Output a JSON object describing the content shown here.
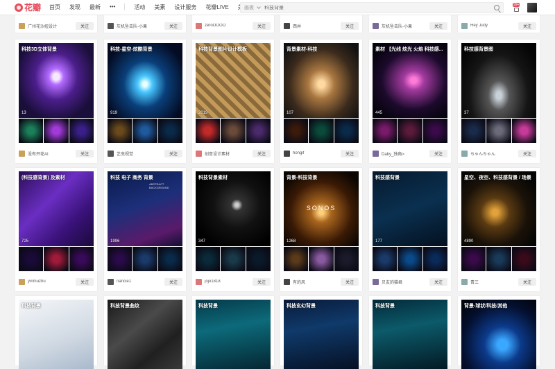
{
  "brand": {
    "logo_text": "花瓣",
    "accent": "#e54d5b"
  },
  "nav": {
    "items": [
      "首页",
      "发现",
      "最新"
    ],
    "more": "•••",
    "items2": [
      "活动",
      "美素",
      "设计服务",
      "花瓣LIVE",
      "美物"
    ]
  },
  "search": {
    "scope": "画板",
    "query": "科技背景"
  },
  "notifications": {
    "badge": "99+"
  },
  "follow_label": "关注",
  "top_row": [
    {
      "user": "广州花沙纽设计"
    },
    {
      "user": "灰机坠击队-小果"
    },
    {
      "user": "zeroOOOO"
    },
    {
      "user": "西井"
    },
    {
      "user": "灰机坠击队-小果"
    },
    {
      "user": "Hey Judy"
    }
  ],
  "row1": [
    {
      "title": "科技3D立体背景",
      "count": "13",
      "user": "没有开花AI"
    },
    {
      "title": "科技-星空-炫酷背景",
      "count": "919",
      "user": "艺虫视觉"
    },
    {
      "title": "科技背景图片设计模板",
      "count": "2019",
      "user": "创意设计素材"
    },
    {
      "title": "背景素材-科技",
      "count": "107",
      "user": "hongif"
    },
    {
      "title": "素材 【光线 炫光 火焰 科技感...",
      "count": "445",
      "user": "Daby_独角>"
    },
    {
      "title": "科技感背景图",
      "count": "37",
      "user": "ちゃんちゃん"
    }
  ],
  "row2": [
    {
      "title": "(科技感背景) 及素材",
      "count": "725",
      "user": "yinmuzhu"
    },
    {
      "title": "科技 电子 商务 背景",
      "count": "1996",
      "user": "nancie1"
    },
    {
      "title": "科技背景素材",
      "count": "347",
      "user": "jojo1818"
    },
    {
      "title": "背景-科技背景",
      "count": "1268",
      "user": "有的风",
      "watermark": "SONOS"
    },
    {
      "title": "科技感背景",
      "count": "177",
      "user": "贝友的猫君"
    },
    {
      "title": "星空、夜空、科技感背景 / 场景",
      "count": "4890",
      "user": "青三"
    }
  ],
  "row3": [
    {
      "title": "科技背景"
    },
    {
      "title": "科技背景曲纹"
    },
    {
      "title": "科技背景"
    },
    {
      "title": "科技玄幻背景"
    },
    {
      "title": "科技背景"
    },
    {
      "title": "背景-球状/科技/其他"
    }
  ],
  "row2_tile2_subtitle": "ABSTRACT BACKGROUND"
}
